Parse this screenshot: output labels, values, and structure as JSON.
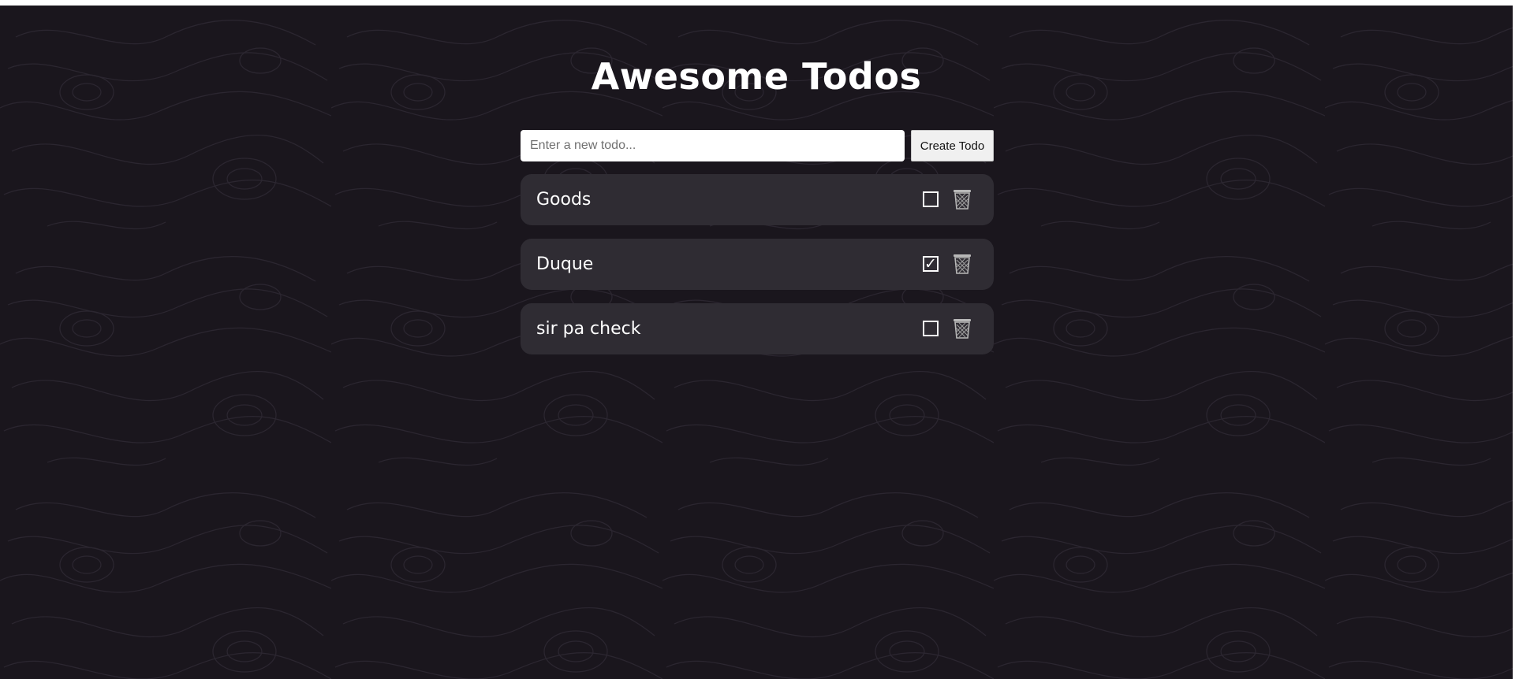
{
  "app": {
    "title": "Awesome Todos"
  },
  "form": {
    "input_placeholder": "Enter a new todo...",
    "input_value": "",
    "create_label": "Create Todo"
  },
  "todos": [
    {
      "text": "Goods",
      "completed": false,
      "check_icon": "checkbox-icon",
      "delete_icon": "trash-icon"
    },
    {
      "text": "Duque",
      "completed": true,
      "check_icon": "checkbox-checked-icon",
      "delete_icon": "trash-icon"
    },
    {
      "text": "sir pa check",
      "completed": false,
      "check_icon": "checkbox-icon",
      "delete_icon": "trash-icon"
    }
  ],
  "colors": {
    "background": "#1a161d",
    "card": "#2f2c33",
    "text": "#ffffff",
    "contour_lines": "#2b2630"
  }
}
